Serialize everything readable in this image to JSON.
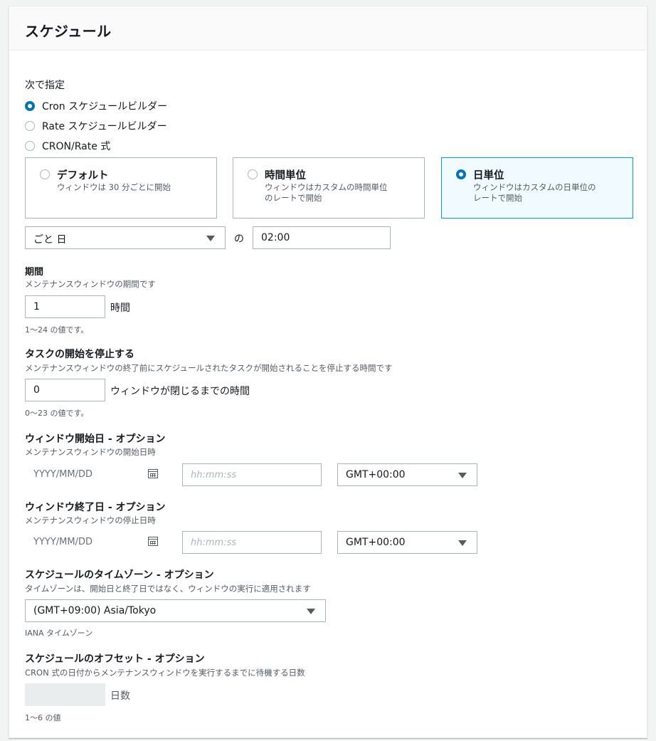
{
  "panel": {
    "title": "スケジュール"
  },
  "specify": {
    "label": "次で指定",
    "options": [
      "Cron スケジュールビルダー",
      "Rate スケジュールビルダー",
      "CRON/Rate 式"
    ],
    "selected_index": 0
  },
  "tiles": [
    {
      "title": "デフォルト",
      "desc_lines": [
        "ウィンドウは 30 分ごとに開始"
      ]
    },
    {
      "title": "時間単位",
      "desc_lines": [
        "ウィンドウはカスタムの時間単位",
        "のレートで開始"
      ]
    },
    {
      "title": "日単位",
      "desc_lines": [
        "ウィンドウはカスタムの日単位の",
        "レートで開始"
      ]
    }
  ],
  "tile_selected_index": 2,
  "frequency": {
    "value": "ごと 日",
    "connector": "の",
    "time": "02:00"
  },
  "duration": {
    "label": "期間",
    "desc": "メンテナンスウィンドウの期間です",
    "value": "1",
    "unit": "時間",
    "hint": "1～24 の値です。"
  },
  "cutoff": {
    "label": "タスクの開始を停止する",
    "desc": "メンテナンスウィンドウの終了前にスケジュールされたタスクが開始されることを停止する時間です",
    "value": "0",
    "unit": "ウィンドウが閉じるまでの時間",
    "hint": "0～23 の値です。"
  },
  "start_date": {
    "label": "ウィンドウ開始日 - オプション",
    "desc": "メンテナンスウィンドウの開始日時",
    "date_placeholder": "YYYY/MM/DD",
    "time_placeholder": "hh:mm:ss",
    "tz": "GMT+00:00"
  },
  "end_date": {
    "label": "ウィンドウ終了日 - オプション",
    "desc": "メンテナンスウィンドウの停止日時",
    "date_placeholder": "YYYY/MM/DD",
    "time_placeholder": "hh:mm:ss",
    "tz": "GMT+00:00"
  },
  "timezone": {
    "label": "スケジュールのタイムゾーン - オプション",
    "desc": "タイムゾーンは、開始日と終了日ではなく、ウィンドウの実行に適用されます",
    "value": "(GMT+09:00) Asia/Tokyo",
    "hint": "IANA タイムゾーン"
  },
  "offset": {
    "label": "スケジュールのオフセット - オプション",
    "desc": "CRON 式の日付からメンテナンスウィンドウを実行するまでに待機する日数",
    "value": "",
    "unit": "日数",
    "hint": "1～6 の値"
  },
  "icons": {
    "calendar": "calendar-icon",
    "dropdown": "caret-down-icon"
  },
  "colors": {
    "accent": "#0073bb",
    "selected_tile_bg": "#f1faff",
    "selected_tile_border": "#00a1c9"
  }
}
